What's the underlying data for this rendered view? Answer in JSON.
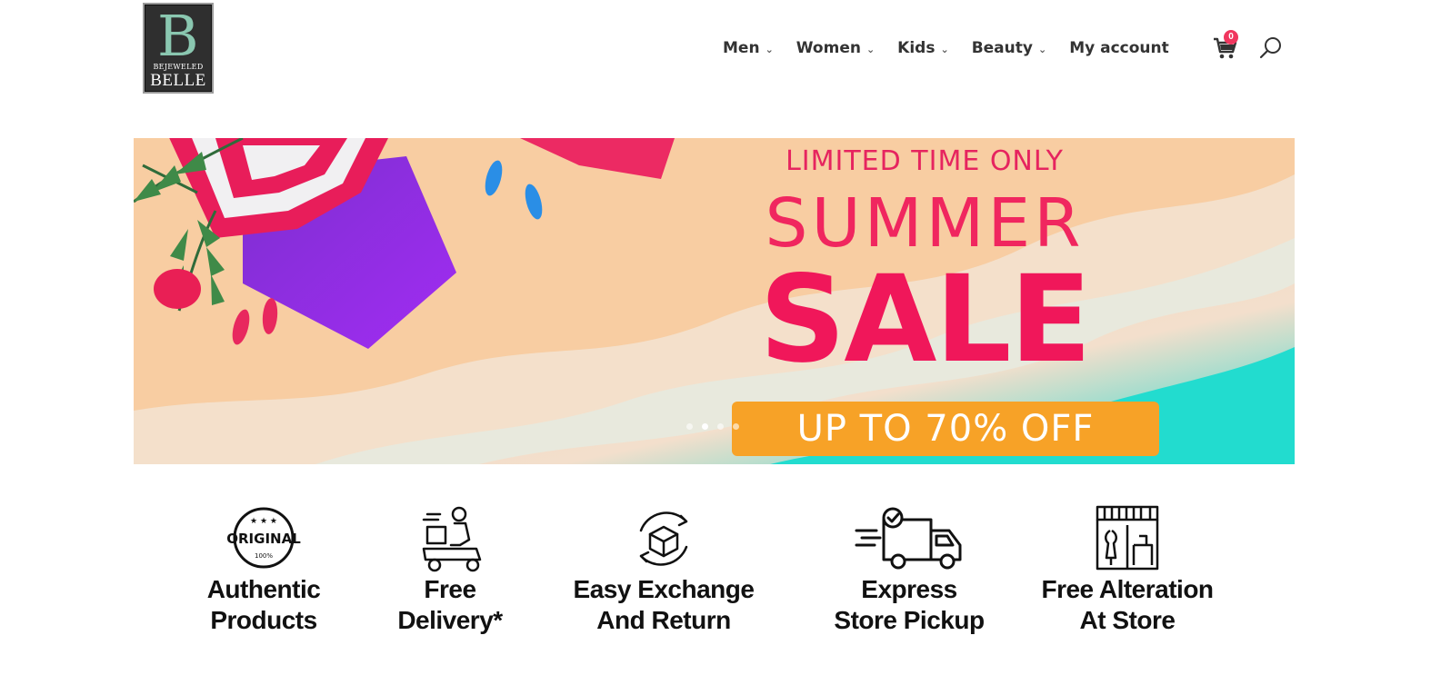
{
  "logo": {
    "letter": "B",
    "small": "BEJEWELED",
    "big": "BELLE"
  },
  "nav": {
    "items": [
      {
        "label": "Men"
      },
      {
        "label": "Women"
      },
      {
        "label": "Kids"
      },
      {
        "label": "Beauty"
      }
    ],
    "account": "My account",
    "cart_count": "0"
  },
  "banner": {
    "line1": "LIMITED TIME ONLY",
    "line2": "SUMMER",
    "line3": "SALE",
    "cta": "UP TO 70% OFF",
    "slides": 4,
    "active_slide": 2
  },
  "features": [
    {
      "icon": "original-seal-icon",
      "badge": "ORIGINAL",
      "badge_small": "100%",
      "line1": "Authentic",
      "line2": "Products"
    },
    {
      "icon": "delivery-scooter-icon",
      "line1": "Free",
      "line2": "Delivery*"
    },
    {
      "icon": "exchange-box-icon",
      "line1": "Easy Exchange",
      "line2": "And Return"
    },
    {
      "icon": "delivery-truck-icon",
      "line1": "Express",
      "line2": "Store Pickup"
    },
    {
      "icon": "storefront-icon",
      "line1": "Free Alteration",
      "line2": "At Store"
    }
  ],
  "colors": {
    "logo_bg": "#2f2f2f",
    "logo_accent": "#8ac7b0",
    "badge": "#f0365e",
    "sale_pink": "#f0175a",
    "cta_orange": "#f7a227",
    "sand": "#f8cfa4",
    "sea": "#1ed9d0"
  }
}
